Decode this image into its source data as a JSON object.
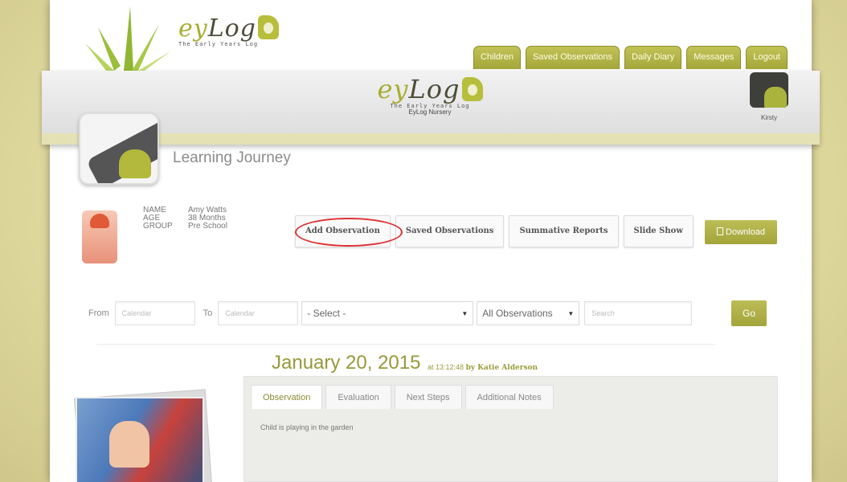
{
  "brand": {
    "word_prefix": "ey",
    "word_rest": "Log",
    "tagline": "The Early Years Log",
    "nursery": "EyLog Nursery"
  },
  "nav": {
    "tabs": [
      "Children",
      "Saved Observations",
      "Daily Diary",
      "Messages",
      "Logout"
    ]
  },
  "user": {
    "name": "Kirsty"
  },
  "page": {
    "title": "Learning Journey"
  },
  "child": {
    "name_label": "NAME",
    "name": "Amy Watts",
    "age_label": "AGE",
    "age": "38 Months",
    "group_label": "GROUP",
    "group": "Pre School"
  },
  "actions": [
    "Add Observation",
    "Saved Observations",
    "Summative Reports",
    "Slide Show"
  ],
  "download": {
    "label": "Download"
  },
  "filter": {
    "from_label": "From",
    "from_placeholder": "Calendar",
    "to_label": "To",
    "to_placeholder": "Calendar",
    "select_value": "- Select -",
    "obs_value": "All Observations",
    "search_placeholder": "Search",
    "go_label": "Go"
  },
  "entry": {
    "date": "January 20, 2015",
    "time": "at 13:12:48",
    "by": "by Katie Alderson",
    "tabs": [
      "Observation",
      "Evaluation",
      "Next Steps",
      "Additional Notes"
    ],
    "active_tab": "Observation",
    "text": "Child is playing in the garden"
  },
  "colors": {
    "accent": "#a8aa3d",
    "highlight_ring": "#dd3333"
  }
}
